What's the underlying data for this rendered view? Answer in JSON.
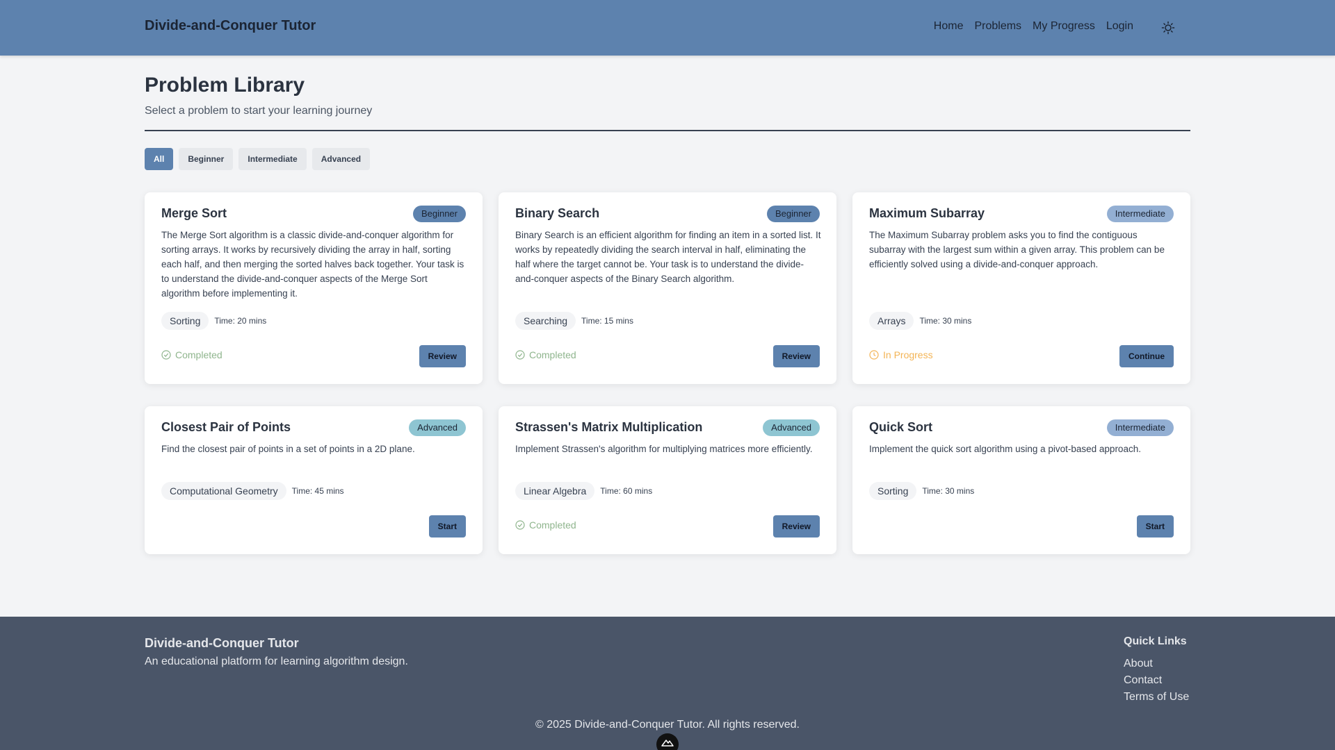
{
  "header": {
    "brand": "Divide-and-Conquer Tutor",
    "nav": [
      "Home",
      "Problems",
      "My Progress",
      "Login"
    ],
    "theme_icon": "sun-icon"
  },
  "page": {
    "title": "Problem Library",
    "subtitle": "Select a problem to start your learning journey"
  },
  "filters": {
    "items": [
      "All",
      "Beginner",
      "Intermediate",
      "Advanced"
    ],
    "active": "All"
  },
  "problems": [
    {
      "title": "Merge Sort",
      "level": "Beginner",
      "description": "The Merge Sort algorithm is a classic divide-and-conquer algorithm for sorting arrays. It works by recursively dividing the array in half, sorting each half, and then merging the sorted halves back together. Your task is to understand the divide-and-conquer aspects of the Merge Sort algorithm before implementing it.",
      "tag": "Sorting",
      "time": "Time: 20 mins",
      "status": "Completed",
      "action": "Review"
    },
    {
      "title": "Binary Search",
      "level": "Beginner",
      "description": "Binary Search is an efficient algorithm for finding an item in a sorted list. It works by repeatedly dividing the search interval in half, eliminating the half where the target cannot be. Your task is to understand the divide-and-conquer aspects of the Binary Search algorithm.",
      "tag": "Searching",
      "time": "Time: 15 mins",
      "status": "Completed",
      "action": "Review"
    },
    {
      "title": "Maximum Subarray",
      "level": "Intermediate",
      "description": "The Maximum Subarray problem asks you to find the contiguous subarray with the largest sum within a given array. This problem can be efficiently solved using a divide-and-conquer approach.",
      "tag": "Arrays",
      "time": "Time: 30 mins",
      "status": "In Progress",
      "action": "Continue"
    },
    {
      "title": "Closest Pair of Points",
      "level": "Advanced",
      "description": "Find the closest pair of points in a set of points in a 2D plane.",
      "tag": "Computational Geometry",
      "time": "Time: 45 mins",
      "status": "",
      "action": "Start"
    },
    {
      "title": "Strassen's Matrix Multiplication",
      "level": "Advanced",
      "description": "Implement Strassen's algorithm for multiplying matrices more efficiently.",
      "tag": "Linear Algebra",
      "time": "Time: 60 mins",
      "status": "Completed",
      "action": "Review"
    },
    {
      "title": "Quick Sort",
      "level": "Intermediate",
      "description": "Implement the quick sort algorithm using a pivot-based approach.",
      "tag": "Sorting",
      "time": "Time: 30 mins",
      "status": "",
      "action": "Start"
    }
  ],
  "footer": {
    "brand": "Divide-and-Conquer Tutor",
    "tagline": "An educational platform for learning algorithm design.",
    "quick_links_title": "Quick Links",
    "quick_links": [
      "About",
      "Contact",
      "Terms of Use"
    ],
    "copyright": "© 2025 Divide-and-Conquer Tutor. All rights reserved."
  },
  "colors": {
    "header": "#5d82ae",
    "beginner": "#5d82ae",
    "intermediate": "#93afd3",
    "advanced": "#8ec5d2",
    "completed": "#8fb58d",
    "in_progress": "#f3b455",
    "footer": "#4a5568"
  }
}
